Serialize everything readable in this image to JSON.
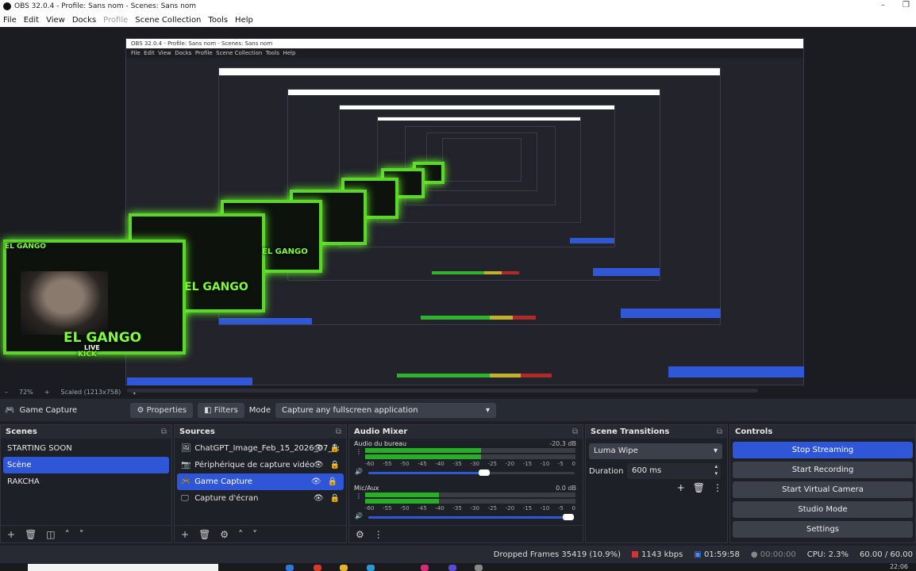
{
  "window": {
    "title": "OBS 32.0.4 - Profile: Sans nom - Scenes: Sans nom",
    "minimize": "–",
    "restore": "❐"
  },
  "menu": [
    "File",
    "Edit",
    "View",
    "Docks",
    "Profile",
    "Scene Collection",
    "Tools",
    "Help"
  ],
  "preview": {
    "nested_title": "OBS 32.0.4 - Profile: Sans nom - Scenes: Sans nom",
    "overlay_name": "EL GANGO",
    "overlay_sub": "LIVE",
    "overlay_brand": "KICK"
  },
  "zoom": {
    "percent": "72%",
    "scaled": "Scaled (1213x758)"
  },
  "source_toolbar": {
    "source_name": "Game Capture",
    "properties": "Properties",
    "filters": "Filters",
    "mode_label": "Mode",
    "mode_value": "Capture any fullscreen application"
  },
  "scenes": {
    "title": "Scenes",
    "items": [
      "STARTING SOON",
      "Scène",
      "RAKCHA"
    ],
    "selected_index": 1
  },
  "sources": {
    "title": "Sources",
    "items": [
      {
        "name": "ChatGPT_Image_Feb_15_2026_07_1:",
        "icon": "image-icon"
      },
      {
        "name": "Périphérique de capture vidéo",
        "icon": "camera-icon"
      },
      {
        "name": "Game Capture",
        "icon": "gamepad-icon"
      },
      {
        "name": "Capture d'écran",
        "icon": "monitor-icon"
      }
    ],
    "selected_index": 2
  },
  "mixer": {
    "title": "Audio Mixer",
    "tracks": [
      {
        "name": "Audio du bureau",
        "db": "-20.3 dB",
        "level": 0.55,
        "volume": 0.56
      },
      {
        "name": "Mic/Aux",
        "db": "0.0 dB",
        "level": 0.35,
        "volume": 0.97
      }
    ],
    "scale": [
      "-60",
      "-55",
      "-50",
      "-45",
      "-40",
      "-35",
      "-30",
      "-25",
      "-20",
      "-15",
      "-10",
      "-5",
      "0"
    ]
  },
  "transitions": {
    "title": "Scene Transitions",
    "selected": "Luma Wipe",
    "duration_label": "Duration",
    "duration_value": "600 ms"
  },
  "controls": {
    "title": "Controls",
    "buttons": [
      "Stop Streaming",
      "Start Recording",
      "Start Virtual Camera",
      "Studio Mode",
      "Settings"
    ]
  },
  "status": {
    "dropped": "Dropped Frames 35419 (10.9%)",
    "bitrate": "1143 kbps",
    "stream_time": "01:59:58",
    "rec_time": "00:00:00",
    "cpu": "CPU: 2.3%",
    "fps": "60.00 / 60.00"
  },
  "taskbar": {
    "time": "22:06"
  },
  "colors": {
    "accent": "#2f56d6",
    "bitrate": "#d13434",
    "overlay_green": "#5cd62b"
  }
}
